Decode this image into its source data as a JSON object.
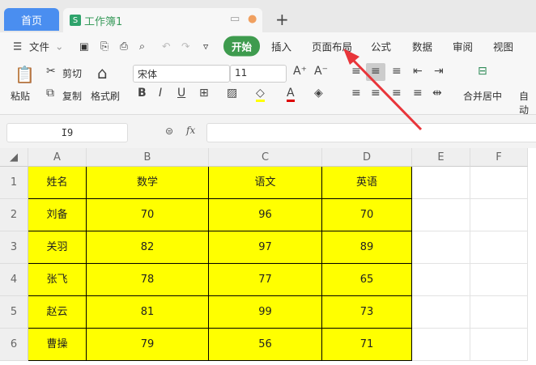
{
  "tabs": {
    "home": "首页",
    "workbook": "工作簿1",
    "new_tab": "+"
  },
  "menu": {
    "file": "文件",
    "items": [
      "开始",
      "插入",
      "页面布局",
      "公式",
      "数据",
      "审阅",
      "视图"
    ]
  },
  "ribbon": {
    "paste": "粘贴",
    "cut": "剪切",
    "copy": "复制",
    "format_painter": "格式刷",
    "font": "宋体",
    "size": "11",
    "merge": "合并居中",
    "auto": "自动"
  },
  "formula": {
    "name_box": "I9",
    "fx": "fx",
    "value": ""
  },
  "columns": [
    "A",
    "B",
    "C",
    "D",
    "E",
    "F"
  ],
  "rows": [
    "1",
    "2",
    "3",
    "4",
    "5",
    "6"
  ],
  "table": [
    [
      "姓名",
      "数学",
      "语文",
      "英语"
    ],
    [
      "刘备",
      "70",
      "96",
      "70"
    ],
    [
      "关羽",
      "82",
      "97",
      "89"
    ],
    [
      "张飞",
      "78",
      "77",
      "65"
    ],
    [
      "赵云",
      "81",
      "99",
      "73"
    ],
    [
      "曹操",
      "79",
      "56",
      "71"
    ]
  ],
  "colors": {
    "highlight": "#ffff00",
    "accent": "#3e9b4e",
    "arrow": "#e8353a"
  }
}
